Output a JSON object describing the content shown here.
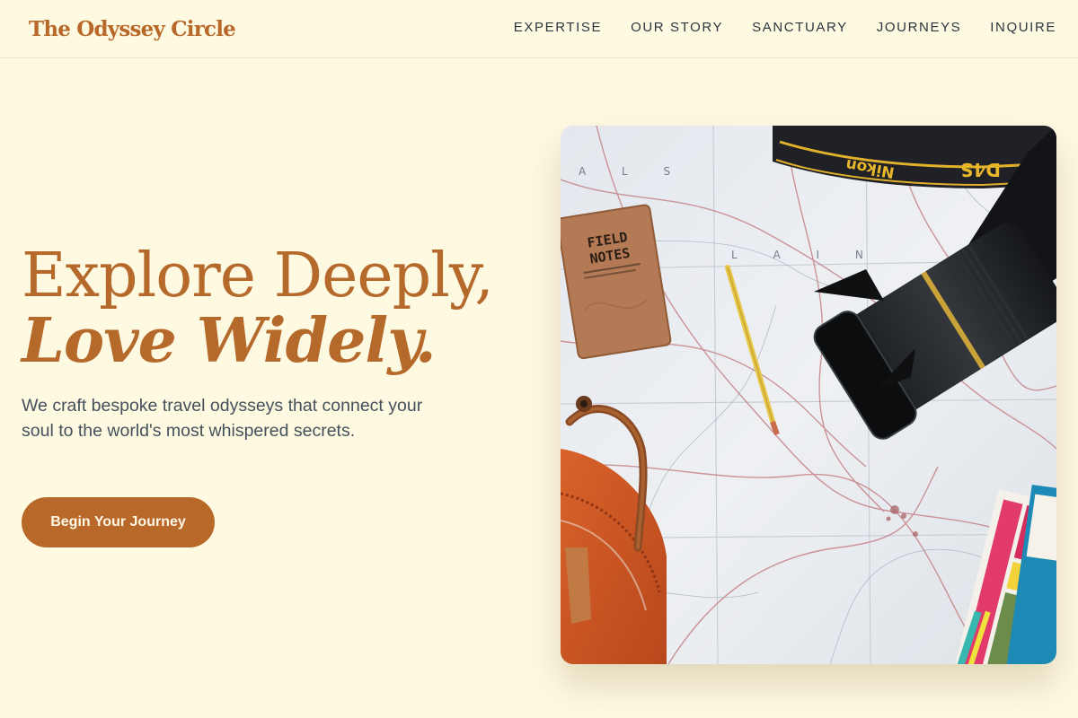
{
  "header": {
    "brand": "The Odyssey Circle",
    "nav": [
      "EXPERTISE",
      "OUR STORY",
      "SANCTUARY",
      "JOURNEYS",
      "INQUIRE"
    ]
  },
  "hero": {
    "title_line1": "Explore Deeply,",
    "title_line2": "Love Widely.",
    "subtitle": "We craft bespoke travel odysseys that connect your soul to the world's most whispered secrets.",
    "cta_label": "Begin Your Journey",
    "image": {
      "notebook_text": "FIELD NOTES",
      "strap_brand": "Nikon",
      "strap_model": "D4S"
    }
  },
  "colors": {
    "background": "#fef9e1",
    "accent": "#b8692a",
    "text": "#45505c"
  }
}
